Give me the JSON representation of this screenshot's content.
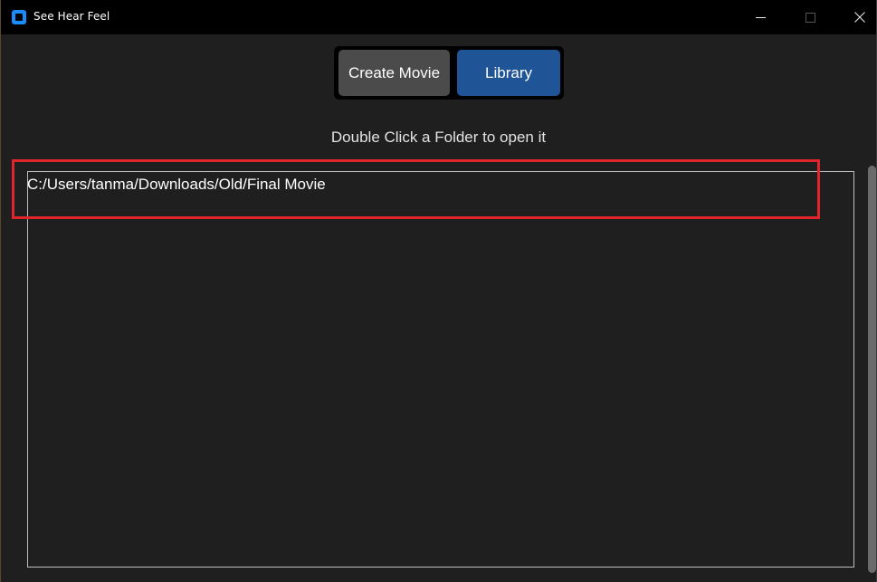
{
  "window": {
    "title": "See Hear Feel"
  },
  "tabs": [
    {
      "label": "Create Movie",
      "selected": false,
      "color": "#4b4b4b"
    },
    {
      "label": "Library",
      "selected": true,
      "color": "#1f5597"
    }
  ],
  "hint": "Double Click a Folder to open it",
  "folders": [
    "C:/Users/tanma/Downloads/Old/Final Movie"
  ],
  "colors": {
    "background": "#1f1f1f",
    "titlebar": "#000000",
    "accent": "#1f5597",
    "highlight_box": "#e0242b"
  },
  "icons": {
    "app": "app-icon",
    "minimize": "minimize-icon",
    "maximize": "maximize-icon",
    "close": "close-icon"
  }
}
